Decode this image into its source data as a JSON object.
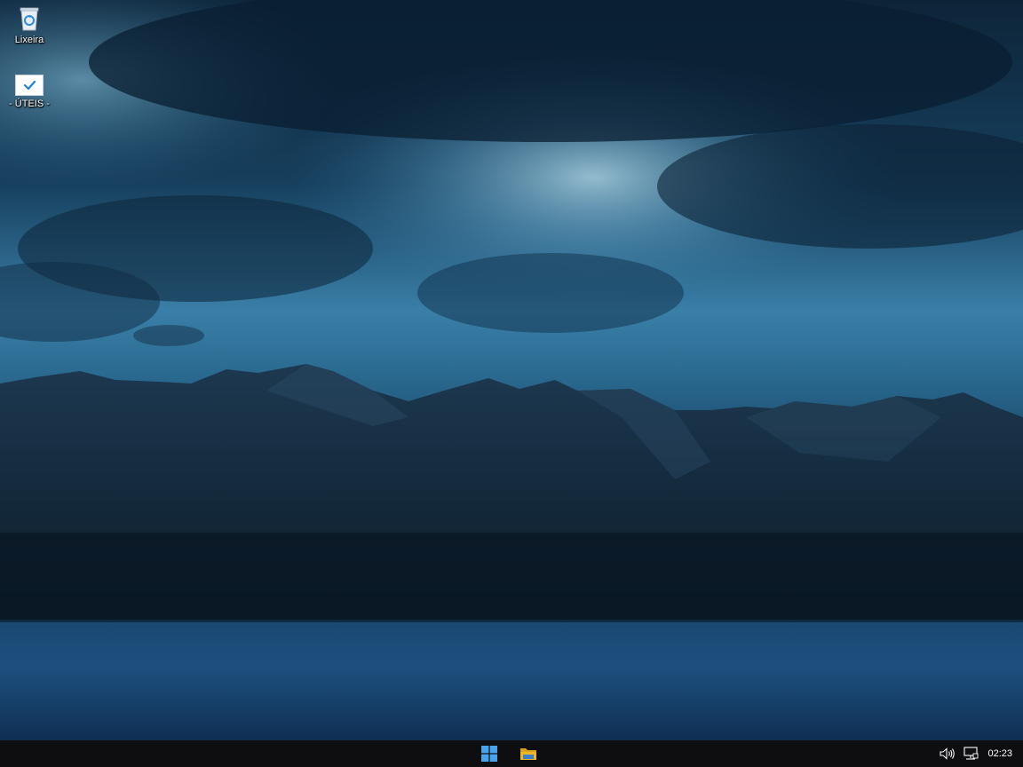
{
  "desktop": {
    "icons": [
      {
        "label": "Lixeira",
        "icon": "recycle-bin-icon"
      },
      {
        "label": "- ÚTEIS -",
        "icon": "checkmark-shortcut-icon"
      }
    ]
  },
  "taskbar": {
    "buttons": [
      {
        "name": "start-button",
        "icon": "windows-logo-icon"
      },
      {
        "name": "file-explorer-button",
        "icon": "folder-icon"
      }
    ],
    "tray": {
      "icons": [
        "speaker-icon",
        "network-icon"
      ],
      "clock": "02:23"
    }
  },
  "colors": {
    "taskbar": "#0e0e10",
    "accent": "#4aa3e8",
    "folder": "#f0b428"
  }
}
